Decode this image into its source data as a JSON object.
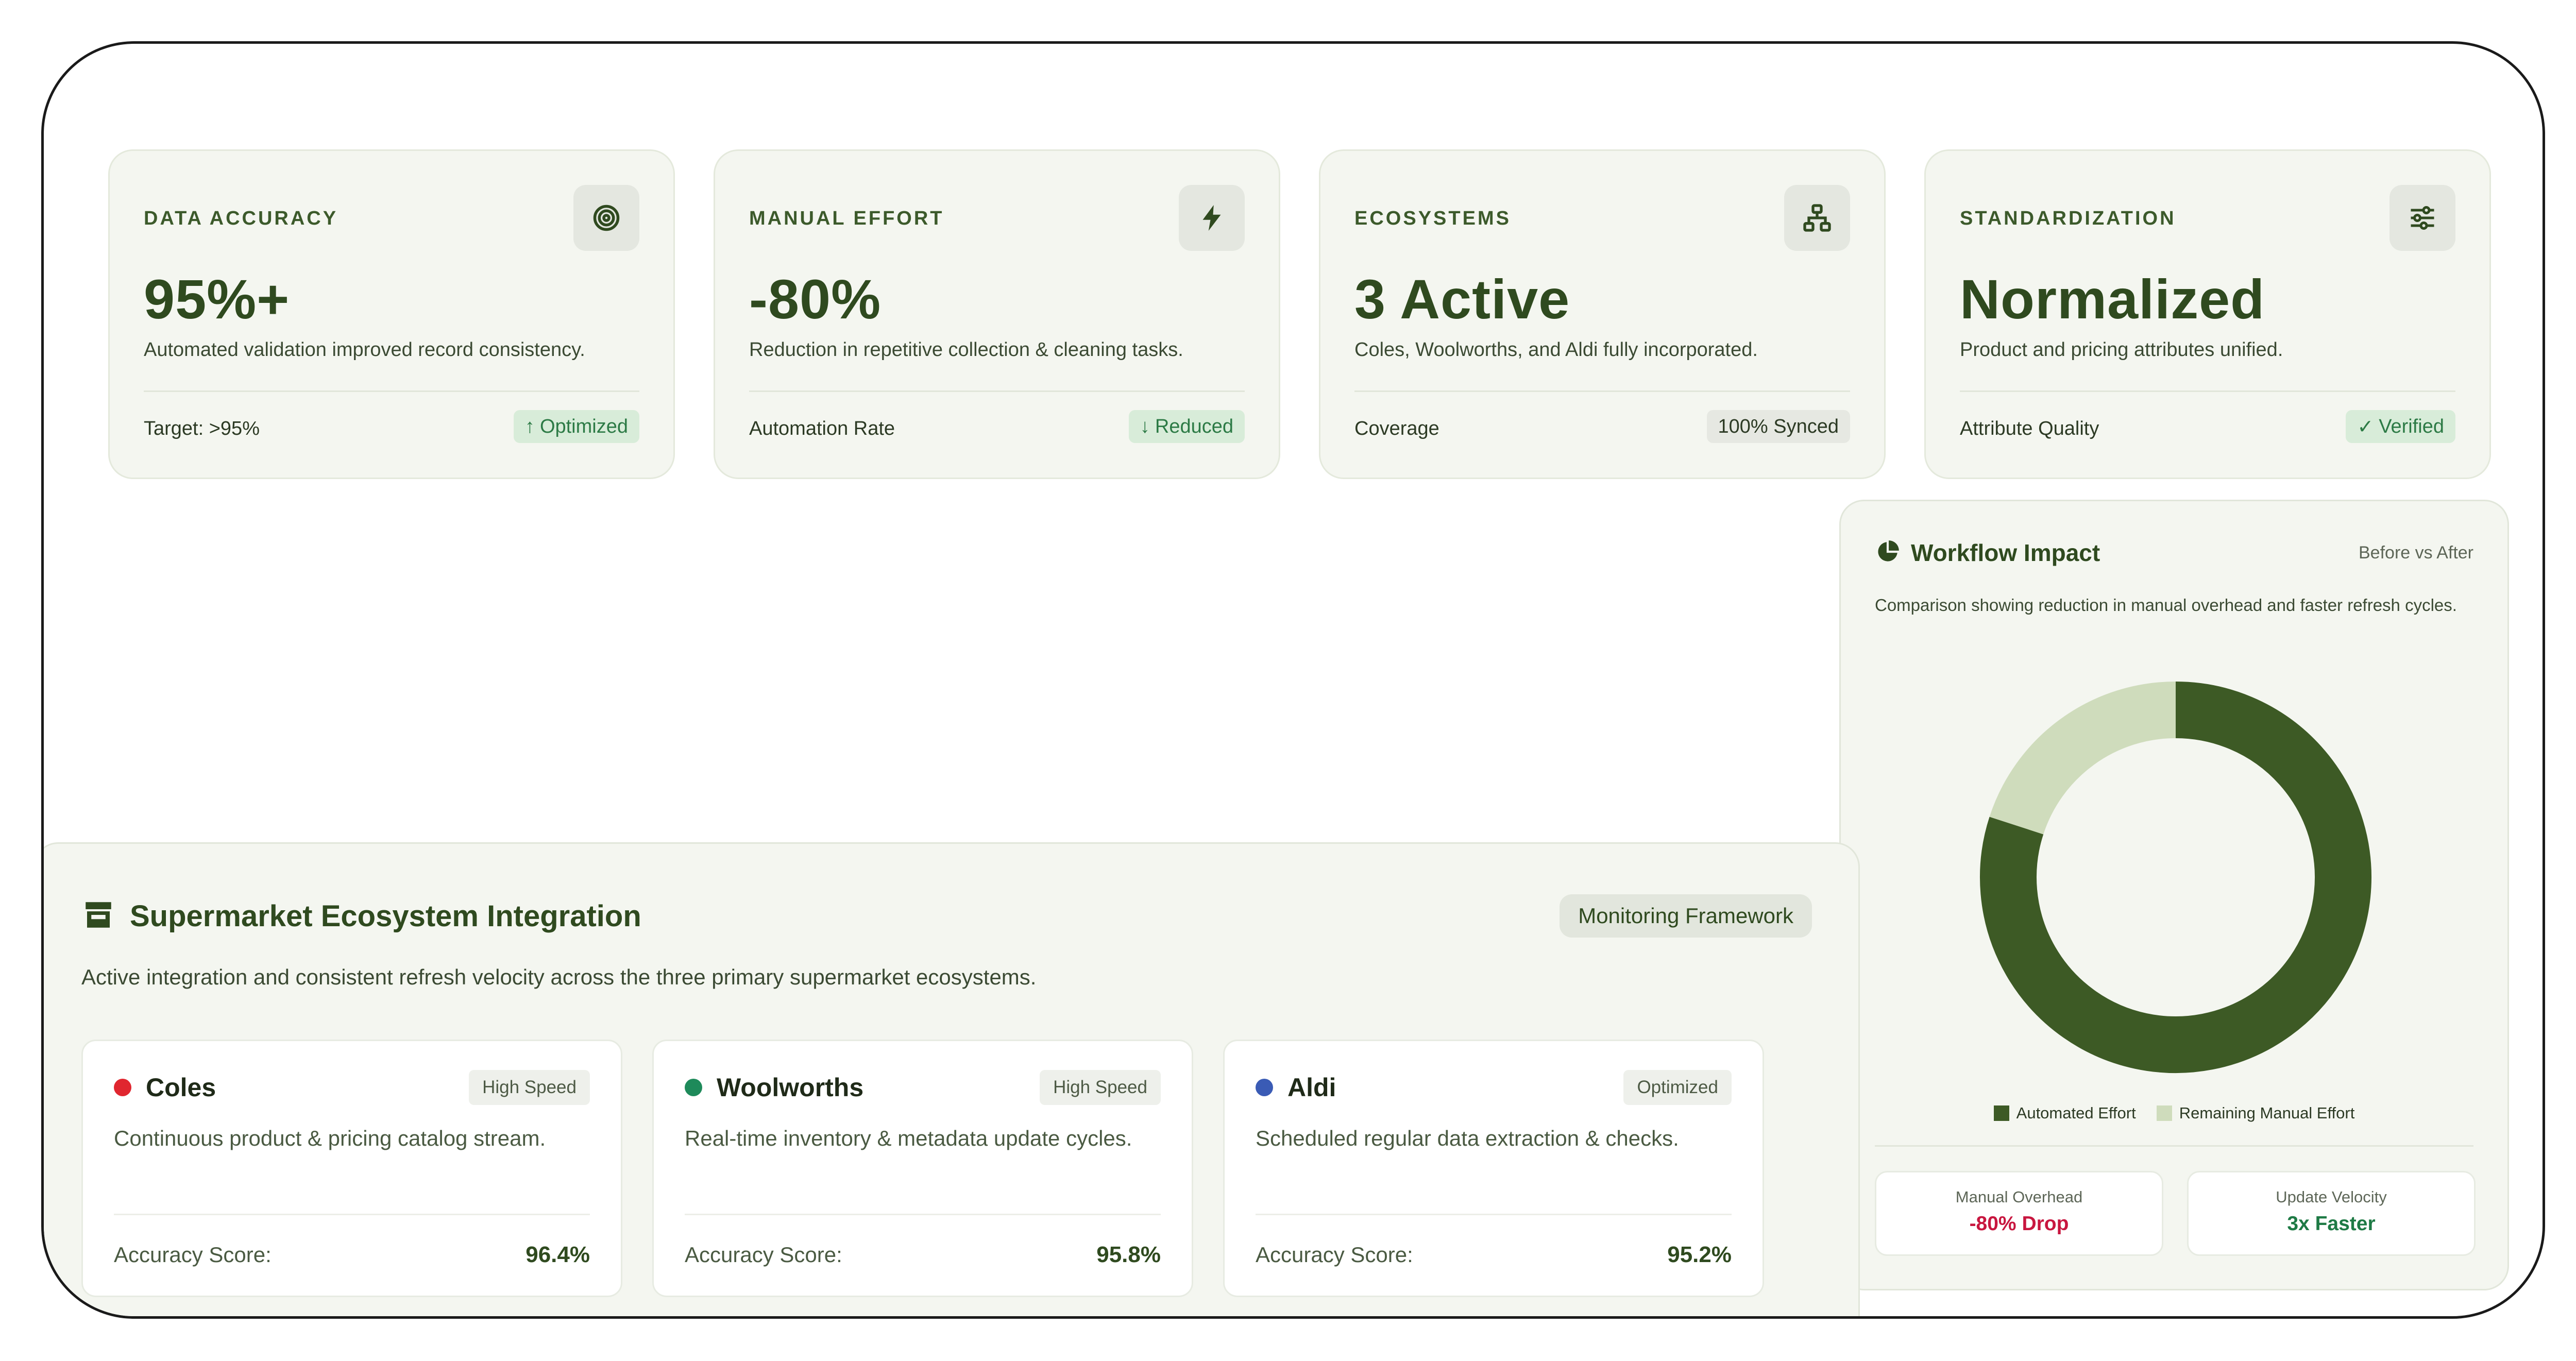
{
  "metrics": [
    {
      "label": "DATA ACCURACY",
      "icon": "target-icon",
      "value": "95%+",
      "desc": "Automated validation improved record consistency.",
      "foot_label": "Target: >95%",
      "badge_icon": "↑",
      "badge_text": "Optimized",
      "badge_style": "green"
    },
    {
      "label": "MANUAL EFFORT",
      "icon": "lightning-icon",
      "value": "-80%",
      "desc": "Reduction in repetitive collection & cleaning tasks.",
      "foot_label": "Automation Rate",
      "badge_icon": "↓",
      "badge_text": "Reduced",
      "badge_style": "green"
    },
    {
      "label": "ECOSYSTEMS",
      "icon": "network-icon",
      "value": "3 Active",
      "desc": "Coles, Woolworths, and Aldi fully incorporated.",
      "foot_label": "Coverage",
      "badge_icon": "",
      "badge_text": "100% Synced",
      "badge_style": "gray"
    },
    {
      "label": "STANDARDIZATION",
      "icon": "sliders-icon",
      "value": "Normalized",
      "desc": "Product and pricing attributes unified.",
      "foot_label": "Attribute Quality",
      "badge_icon": "✓",
      "badge_text": "Verified",
      "badge_style": "green"
    }
  ],
  "workflow": {
    "icon": "pie-chart-icon",
    "title": "Workflow Impact",
    "subtitle_right": "Before vs After",
    "description": "Comparison showing reduction in manual overhead and faster refresh cycles.",
    "stats": [
      {
        "label": "Manual Overhead",
        "value": "-80% Drop",
        "color": "#c8163f"
      },
      {
        "label": "Update Velocity",
        "value": "3x Faster",
        "color": "#1e7a45"
      }
    ]
  },
  "chart_data": {
    "type": "pie",
    "style": "donut",
    "categories": [
      "Automated Effort",
      "Remaining Manual Effort"
    ],
    "values": [
      80,
      20
    ],
    "colors": [
      "#3d5a25",
      "#cfdcbc"
    ],
    "legend_position": "bottom"
  },
  "supermarket": {
    "icon": "store-icon",
    "title": "Supermarket Ecosystem Integration",
    "badge": "Monitoring Framework",
    "description": "Active integration and consistent refresh velocity across the three primary supermarket ecosystems.",
    "cards": [
      {
        "name": "Coles",
        "dot_color": "#e0262f",
        "speed": "High Speed",
        "desc": "Continuous product & pricing catalog stream.",
        "score_label": "Accuracy Score:",
        "score": "96.4%"
      },
      {
        "name": "Woolworths",
        "dot_color": "#1e8a5a",
        "speed": "High Speed",
        "desc": "Real-time inventory & metadata update cycles.",
        "score_label": "Accuracy Score:",
        "score": "95.8%"
      },
      {
        "name": "Aldi",
        "dot_color": "#3a5bb5",
        "speed": "Optimized",
        "desc": "Scheduled regular data extraction & checks.",
        "score_label": "Accuracy Score:",
        "score": "95.2%"
      }
    ]
  }
}
